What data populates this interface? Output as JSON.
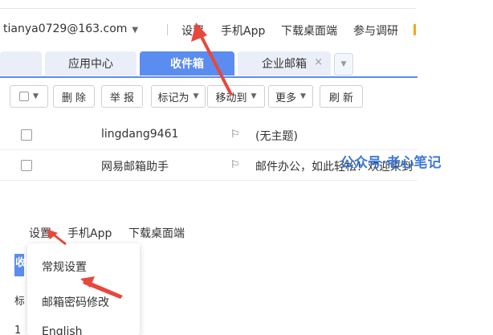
{
  "topbar": {
    "account": "tianya0729@163.com",
    "links": [
      "设置",
      "手机App",
      "下载桌面端",
      "参与调研"
    ]
  },
  "tabs": [
    {
      "label": "应用中心",
      "active": false
    },
    {
      "label": "收件箱",
      "active": true
    },
    {
      "label": "企业邮箱",
      "active": false,
      "close": "×"
    }
  ],
  "toolbar": {
    "delete": "删 除",
    "report": "举 报",
    "mark_as": "标记为",
    "move_to": "移动到",
    "more": "更多",
    "refresh": "刷 新"
  },
  "mail_list": [
    {
      "sender": "lingdang9461",
      "subject": "(无主题)"
    },
    {
      "sender": "网易邮箱助手",
      "subject": "邮件办公，如此轻松！欢迎来到"
    }
  ],
  "watermark": "公众号·老心笔记",
  "lower_nav": [
    "设置",
    "手机App",
    "下载桌面端"
  ],
  "settings_menu": [
    "常规设置",
    "邮箱密码修改",
    "English"
  ],
  "stubs": {
    "tab": "收",
    "row1": "标记",
    "row2": "1"
  },
  "colors": {
    "accent": "#5b8cf0",
    "arrow": "#e8473c",
    "watermark": "#2f6fd8"
  }
}
